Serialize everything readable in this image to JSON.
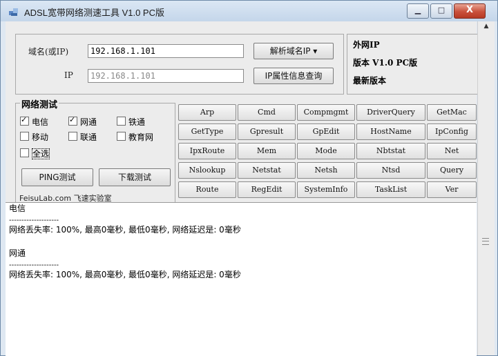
{
  "window": {
    "title": "ADSL宽带网络测速工具 V1.0 PC版"
  },
  "title_controls": {
    "min": "▁",
    "max": "□",
    "close": "X"
  },
  "domain_row": {
    "label": "域名(或IP)",
    "value": "192.168.1.101",
    "button": "解析域名IP ▾"
  },
  "ip_row": {
    "label": "IP",
    "placeholder": "192.168.1.101",
    "button": "IP属性信息查询"
  },
  "info": {
    "line1": "外网IP",
    "line2": "版本 V1.0 PC版",
    "line3": "最新版本"
  },
  "network_test": {
    "title": "网络测试",
    "checkboxes": [
      {
        "label": "电信",
        "checked": true
      },
      {
        "label": "网通",
        "checked": true
      },
      {
        "label": "铁通",
        "checked": false
      },
      {
        "label": "移动",
        "checked": false
      },
      {
        "label": "联通",
        "checked": false
      },
      {
        "label": "教育网",
        "checked": false
      },
      {
        "label": "全选",
        "checked": false
      }
    ],
    "ping_button": "PING测试",
    "download_button": "下载测试",
    "footer": "FeisuLab.com 飞速实验室"
  },
  "commands": [
    [
      "Arp",
      "Cmd",
      "Compmgmt",
      "DriverQuery",
      "GetMac"
    ],
    [
      "GetType",
      "Gpresult",
      "GpEdit",
      "HostName",
      "IpConfig"
    ],
    [
      "IpxRoute",
      "Mem",
      "Mode",
      "Nbtstat",
      "Net"
    ],
    [
      "Nslookup",
      "Netstat",
      "Netsh",
      "Ntsd",
      "Query"
    ],
    [
      "Route",
      "RegEdit",
      "SystemInfo",
      "TaskList",
      "Ver"
    ]
  ],
  "output": [
    "电信",
    "--------------------",
    "网络丢失率: 100%, 最高0毫秒, 最低0毫秒, 网络延迟是: 0毫秒",
    "",
    "网通",
    "--------------------",
    "网络丢失率: 100%, 最高0毫秒, 最低0毫秒, 网络延迟是: 0毫秒"
  ]
}
